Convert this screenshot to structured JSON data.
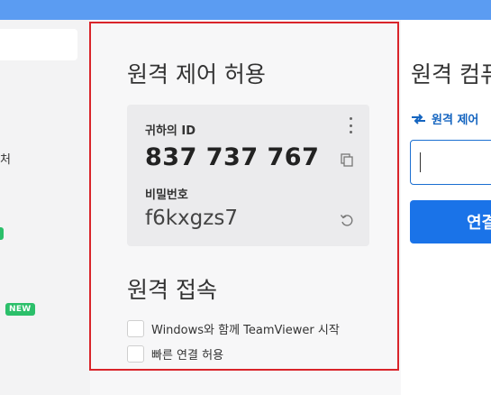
{
  "left": {
    "item_text": "처",
    "new_badge": "NEW"
  },
  "remote_control": {
    "title": "원격 제어 허용",
    "your_id_label": "귀하의 ID",
    "your_id": "837 737 767",
    "password_label": "비밀번호",
    "password": "f6kxgzs7"
  },
  "unattended": {
    "title": "원격 접속",
    "options": [
      {
        "label": "Windows와 함께 TeamViewer 시작",
        "checked": false
      },
      {
        "label": "빠른 연결 허용",
        "checked": false
      }
    ]
  },
  "control_remote": {
    "title": "원격 컴퓨",
    "mode_label": "원격 제어",
    "partner_id_value": "",
    "connect_label": "연결"
  },
  "colors": {
    "accent": "#1a73e8",
    "highlight": "#d9242a",
    "new_badge": "#2bbf6a"
  }
}
